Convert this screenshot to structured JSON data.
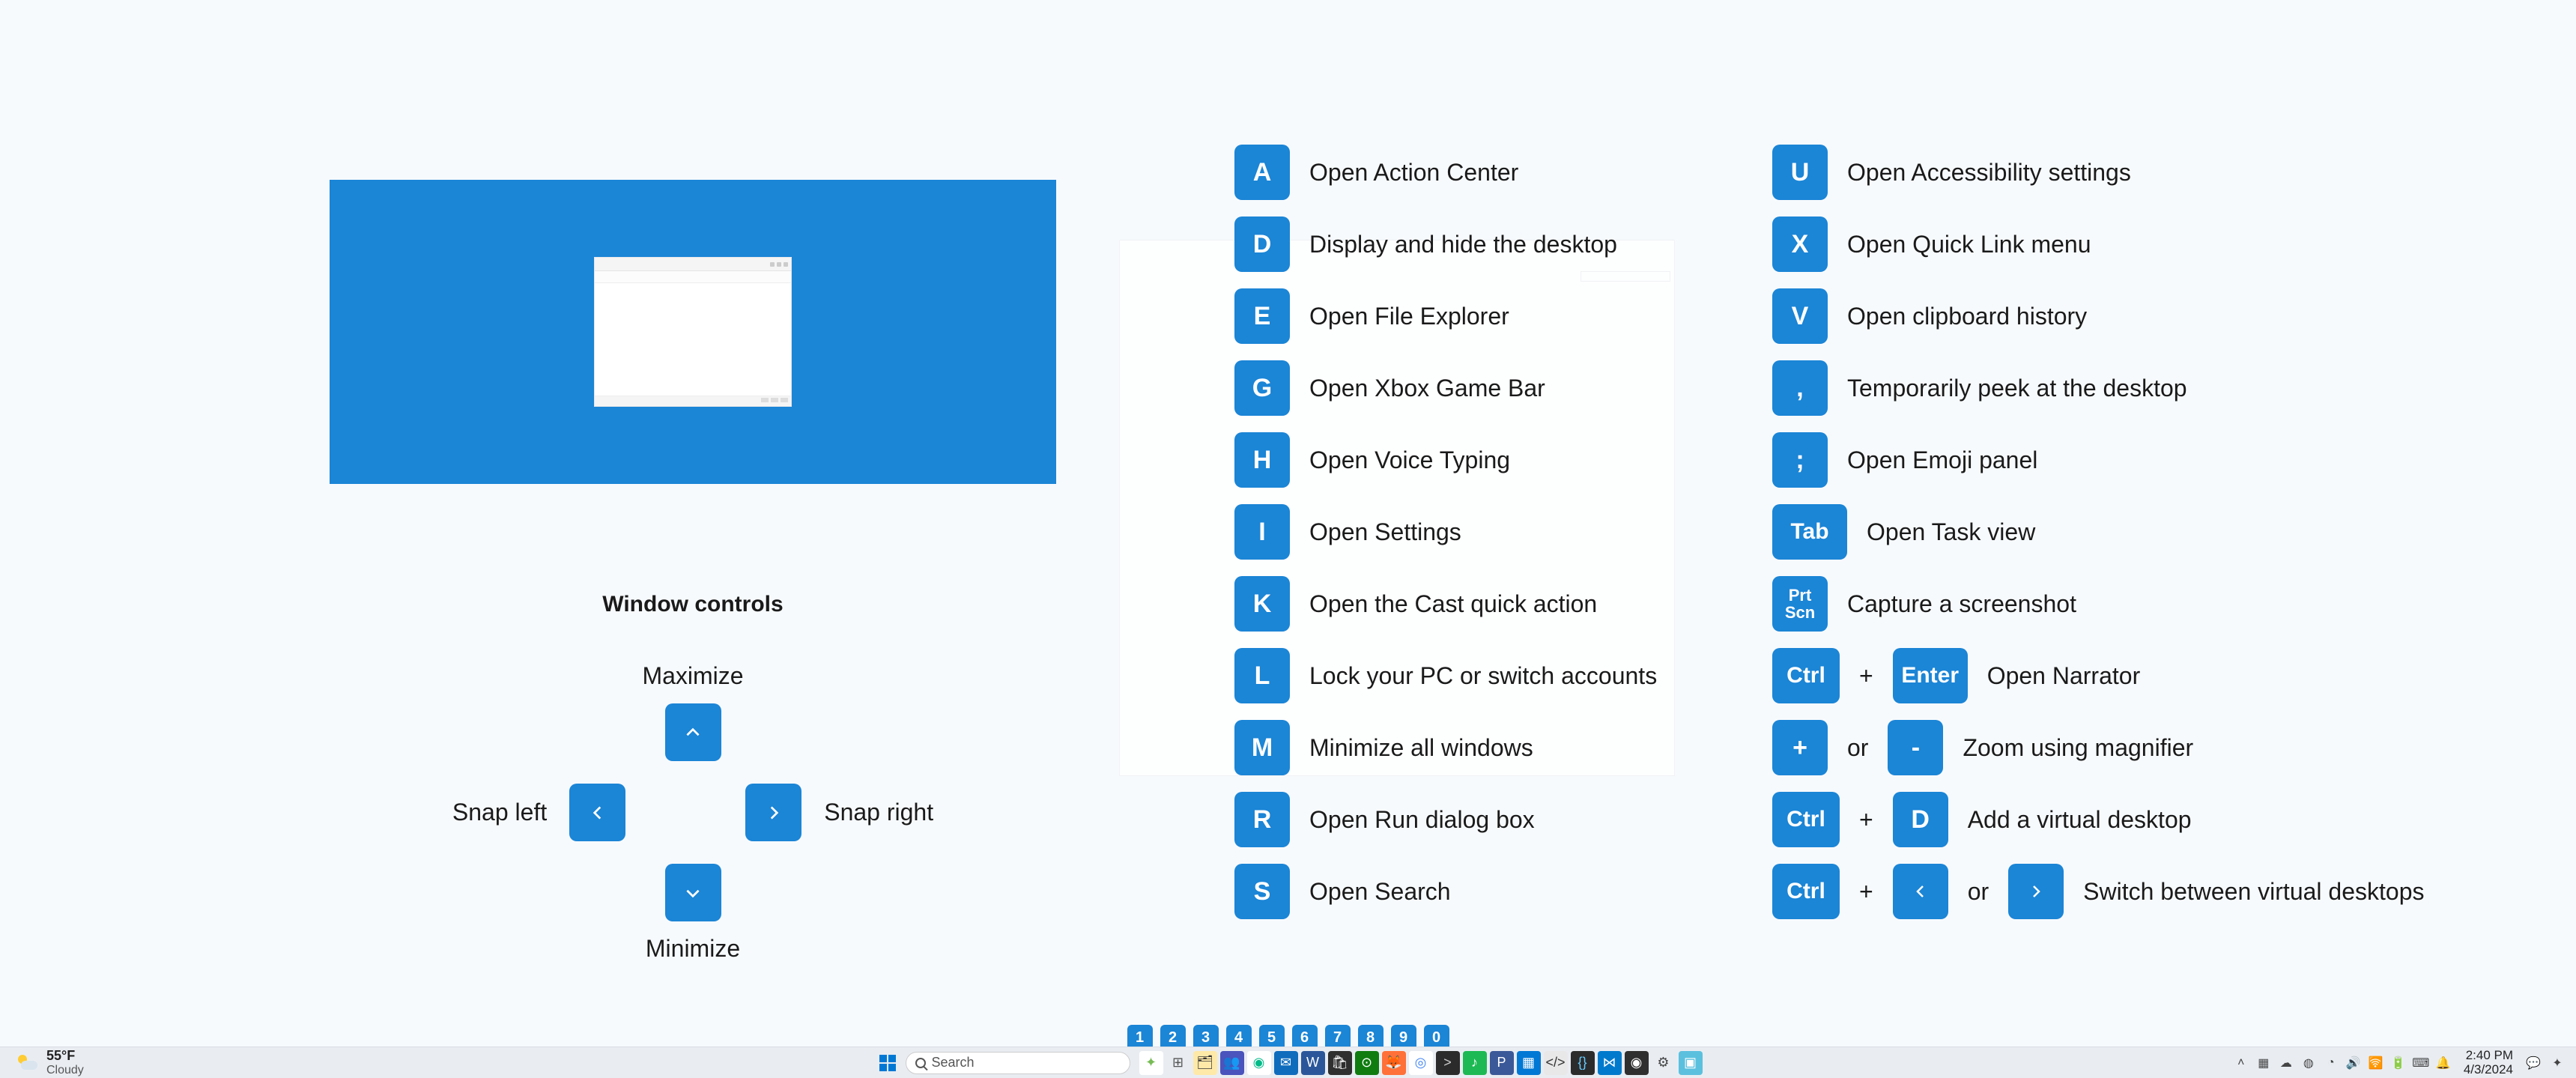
{
  "window_controls": {
    "title": "Window controls",
    "maximize": "Maximize",
    "minimize": "Minimize",
    "snap_left": "Snap left",
    "snap_right": "Snap right"
  },
  "shortcuts_col1": [
    {
      "keys": [
        {
          "t": "k",
          "v": "A"
        }
      ],
      "label": "Open Action Center"
    },
    {
      "keys": [
        {
          "t": "k",
          "v": "D"
        }
      ],
      "label": "Display and hide the desktop"
    },
    {
      "keys": [
        {
          "t": "k",
          "v": "E"
        }
      ],
      "label": "Open File Explorer"
    },
    {
      "keys": [
        {
          "t": "k",
          "v": "G"
        }
      ],
      "label": "Open Xbox Game Bar"
    },
    {
      "keys": [
        {
          "t": "k",
          "v": "H"
        }
      ],
      "label": "Open Voice Typing"
    },
    {
      "keys": [
        {
          "t": "k",
          "v": "I"
        }
      ],
      "label": "Open Settings"
    },
    {
      "keys": [
        {
          "t": "k",
          "v": "K"
        }
      ],
      "label": "Open the Cast quick action"
    },
    {
      "keys": [
        {
          "t": "k",
          "v": "L"
        }
      ],
      "label": "Lock your PC or switch accounts"
    },
    {
      "keys": [
        {
          "t": "k",
          "v": "M"
        }
      ],
      "label": "Minimize all windows"
    },
    {
      "keys": [
        {
          "t": "k",
          "v": "R"
        }
      ],
      "label": "Open Run dialog box"
    },
    {
      "keys": [
        {
          "t": "k",
          "v": "S"
        }
      ],
      "label": "Open Search"
    }
  ],
  "shortcuts_col2": [
    {
      "keys": [
        {
          "t": "k",
          "v": "U"
        }
      ],
      "label": "Open Accessibility settings"
    },
    {
      "keys": [
        {
          "t": "k",
          "v": "X"
        }
      ],
      "label": "Open Quick Link menu"
    },
    {
      "keys": [
        {
          "t": "k",
          "v": "V"
        }
      ],
      "label": "Open clipboard history"
    },
    {
      "keys": [
        {
          "t": "k",
          "v": ","
        }
      ],
      "label": "Temporarily peek at the desktop"
    },
    {
      "keys": [
        {
          "t": "k",
          "v": ";"
        }
      ],
      "label": "Open Emoji panel"
    },
    {
      "keys": [
        {
          "t": "k",
          "v": "Tab",
          "cls": "wide"
        }
      ],
      "label": "Open Task view"
    },
    {
      "keys": [
        {
          "t": "ml",
          "v": "Prt\nScn"
        }
      ],
      "label": "Capture a screenshot"
    },
    {
      "keys": [
        {
          "t": "k",
          "v": "Ctrl",
          "cls": "ctrl"
        },
        {
          "t": "j",
          "v": "+"
        },
        {
          "t": "k",
          "v": "Enter",
          "cls": "wide"
        }
      ],
      "label": "Open Narrator"
    },
    {
      "keys": [
        {
          "t": "k",
          "v": "+"
        },
        {
          "t": "j",
          "v": "or"
        },
        {
          "t": "k",
          "v": "-"
        }
      ],
      "label": "Zoom using magnifier"
    },
    {
      "keys": [
        {
          "t": "k",
          "v": "Ctrl",
          "cls": "ctrl"
        },
        {
          "t": "j",
          "v": "+"
        },
        {
          "t": "k",
          "v": "D"
        }
      ],
      "label": "Add a virtual desktop"
    },
    {
      "keys": [
        {
          "t": "k",
          "v": "Ctrl",
          "cls": "ctrl"
        },
        {
          "t": "j",
          "v": "+"
        },
        {
          "t": "al",
          "v": ""
        },
        {
          "t": "j",
          "v": "or"
        },
        {
          "t": "ar",
          "v": ""
        }
      ],
      "label": "Switch between virtual desktops"
    }
  ],
  "pager": [
    "1",
    "2",
    "3",
    "4",
    "5",
    "6",
    "7",
    "8",
    "9",
    "0"
  ],
  "taskbar": {
    "weather_temp": "55°F",
    "weather_cond": "Cloudy",
    "search_placeholder": "Search",
    "clock_time": "2:40 PM",
    "clock_date": "4/3/2024",
    "apps": [
      {
        "name": "copilot",
        "bg": "#ffffff",
        "fg": "#7b5",
        "glyph": "✦"
      },
      {
        "name": "task-view",
        "bg": "transparent",
        "fg": "#555",
        "glyph": "⊞"
      },
      {
        "name": "file-explorer",
        "bg": "#ffe9a8",
        "fg": "#333",
        "glyph": "🗂"
      },
      {
        "name": "teams",
        "bg": "#4b53bc",
        "fg": "#fff",
        "glyph": "👥"
      },
      {
        "name": "edge",
        "bg": "#ffffff",
        "fg": "#0b8",
        "glyph": "◉"
      },
      {
        "name": "outlook",
        "bg": "#0f6cbd",
        "fg": "#fff",
        "glyph": "✉"
      },
      {
        "name": "word",
        "bg": "#2b579a",
        "fg": "#fff",
        "glyph": "W"
      },
      {
        "name": "store",
        "bg": "#2f2f2f",
        "fg": "#fff",
        "glyph": "🛍"
      },
      {
        "name": "xbox",
        "bg": "#107c10",
        "fg": "#fff",
        "glyph": "⊙"
      },
      {
        "name": "firefox",
        "bg": "#ff7139",
        "fg": "#fff",
        "glyph": "🦊"
      },
      {
        "name": "chrome",
        "bg": "#ffffff",
        "fg": "#4285f4",
        "glyph": "◎"
      },
      {
        "name": "terminal",
        "bg": "#2b2b2b",
        "fg": "#ccc",
        "glyph": ">"
      },
      {
        "name": "music",
        "bg": "#1db954",
        "fg": "#fff",
        "glyph": "♪"
      },
      {
        "name": "p-app",
        "bg": "#3b5998",
        "fg": "#fff",
        "glyph": "P"
      },
      {
        "name": "calendar",
        "bg": "#0078d4",
        "fg": "#fff",
        "glyph": "▦"
      },
      {
        "name": "code-1",
        "bg": "#e8e8e8",
        "fg": "#333",
        "glyph": "</>"
      },
      {
        "name": "code-2",
        "bg": "#2b2b2b",
        "fg": "#6cf",
        "glyph": "{}"
      },
      {
        "name": "vscode",
        "bg": "#007acc",
        "fg": "#fff",
        "glyph": "⋈"
      },
      {
        "name": "obs",
        "bg": "#2f2f2f",
        "fg": "#fff",
        "glyph": "◉"
      },
      {
        "name": "settings",
        "bg": "transparent",
        "fg": "#444",
        "glyph": "⚙"
      },
      {
        "name": "app-x",
        "bg": "#5bc0de",
        "fg": "#fff",
        "glyph": "▣"
      }
    ],
    "tray": [
      "˄",
      "▦",
      "☁",
      "◍",
      "◔",
      "🔊",
      "🛜",
      "🔋",
      "⌨",
      "🔔"
    ]
  }
}
